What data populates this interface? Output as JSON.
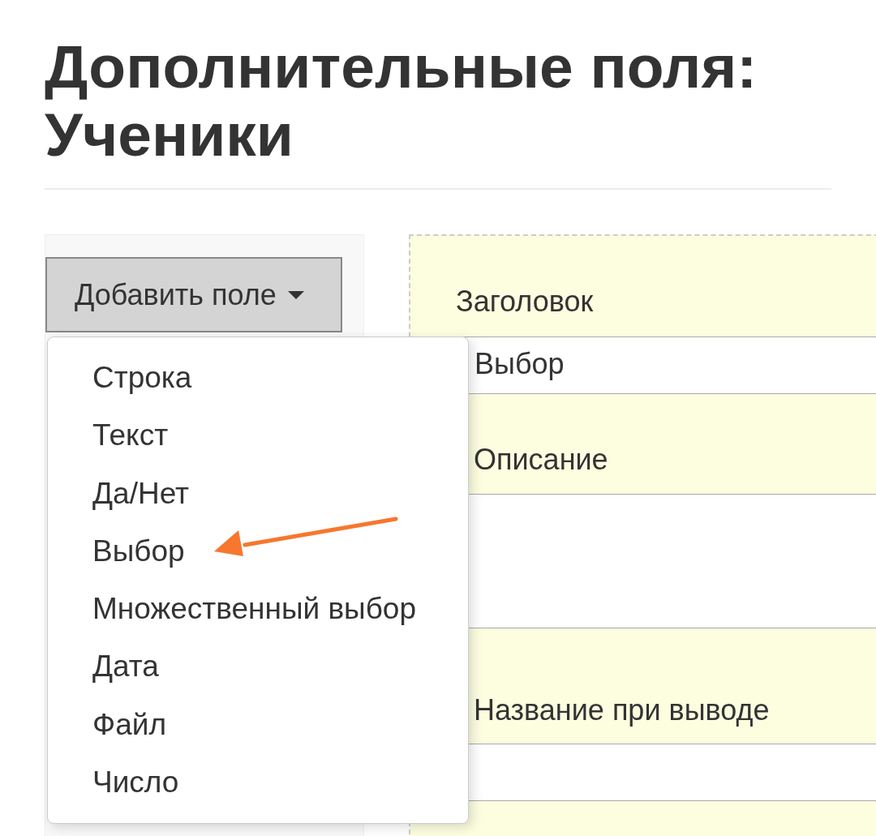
{
  "page": {
    "title": "Дополнительные поля:\nУченики"
  },
  "add_button": {
    "label": "Добавить поле"
  },
  "dropdown": {
    "items": [
      {
        "label": "Строка"
      },
      {
        "label": "Текст"
      },
      {
        "label": "Да/Нет"
      },
      {
        "label": "Выбор"
      },
      {
        "label": "Множественный выбор"
      },
      {
        "label": "Дата"
      },
      {
        "label": "Файл"
      },
      {
        "label": "Число"
      }
    ]
  },
  "form": {
    "fields": [
      {
        "kind": "input",
        "label": "Заголовок",
        "value": "Выбор"
      },
      {
        "kind": "textarea",
        "label": "Описание"
      },
      {
        "kind": "input",
        "label": "Название при выводе"
      }
    ]
  }
}
